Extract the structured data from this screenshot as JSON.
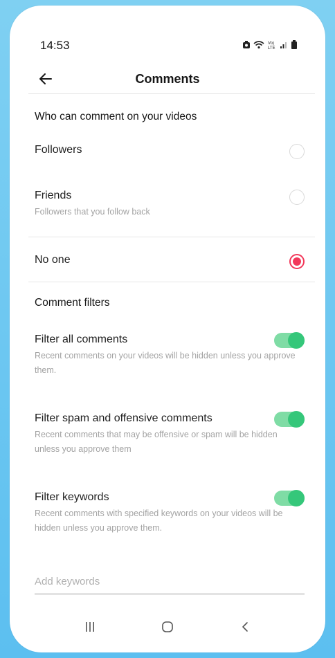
{
  "status_bar": {
    "time": "14:53",
    "icons": [
      "alarm-icon",
      "wifi-icon",
      "volte-icon",
      "signal-icon",
      "battery-icon"
    ],
    "volte_text": "Vo)\nLTE"
  },
  "header": {
    "title": "Comments",
    "back_icon": "arrow-left-icon"
  },
  "who_can_comment": {
    "heading": "Who can comment on your videos",
    "options": [
      {
        "label": "Followers",
        "selected": false
      },
      {
        "label": "Friends",
        "sublabel": "Followers that you follow back",
        "selected": false
      },
      {
        "label": "No one",
        "selected": true
      }
    ]
  },
  "comment_filters": {
    "heading": "Comment filters",
    "items": [
      {
        "label": "Filter all comments",
        "description": "Recent comments on your videos will be hidden unless you approve them.",
        "enabled": true
      },
      {
        "label": "Filter spam and offensive comments",
        "description": "Recent comments that may be offensive or spam will be hidden unless you approve them",
        "enabled": true
      },
      {
        "label": "Filter keywords",
        "description": "Recent comments with specified keywords on your videos will be hidden unless you approve them.",
        "enabled": true
      }
    ]
  },
  "keywords_input": {
    "placeholder": "Add keywords",
    "value": ""
  },
  "nav_bar": {
    "buttons": [
      "recents-icon",
      "home-icon",
      "back-icon"
    ]
  },
  "colors": {
    "radio_selected": "#f2385a",
    "toggle_on_track": "#7fdca5",
    "toggle_on_knob": "#35c77a",
    "background": "#5cbff0"
  }
}
